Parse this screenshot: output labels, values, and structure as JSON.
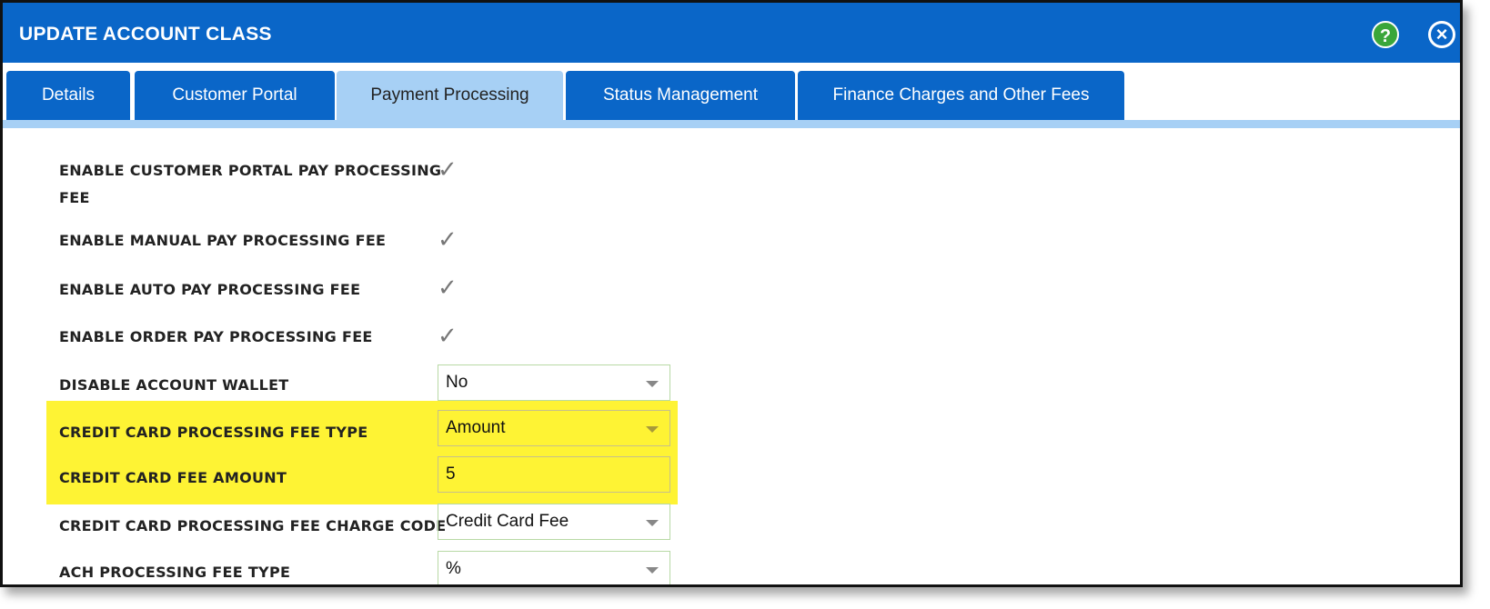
{
  "dialog": {
    "title": "UPDATE ACCOUNT CLASS"
  },
  "icons": {
    "help": "?",
    "close": "×"
  },
  "tabs": [
    {
      "label": "Details"
    },
    {
      "label": "Customer Portal"
    },
    {
      "label": "Payment Processing"
    },
    {
      "label": "Status Management"
    },
    {
      "label": "Finance Charges and Other Fees"
    }
  ],
  "form": {
    "enable_customer_portal_fee": {
      "label_line1": "ENABLE CUSTOMER PORTAL PAY PROCESSING",
      "label_line2": "FEE",
      "checked": true
    },
    "enable_manual_fee": {
      "label": "ENABLE MANUAL PAY PROCESSING FEE",
      "checked": true
    },
    "enable_auto_fee": {
      "label": "ENABLE AUTO PAY PROCESSING FEE",
      "checked": true
    },
    "enable_order_fee": {
      "label": "ENABLE ORDER PAY PROCESSING FEE",
      "checked": true
    },
    "disable_wallet": {
      "label": "DISABLE ACCOUNT WALLET",
      "value": "No"
    },
    "cc_fee_type": {
      "label": "CREDIT CARD PROCESSING FEE TYPE",
      "value": "Amount"
    },
    "cc_fee_amount": {
      "label": "CREDIT CARD FEE AMOUNT",
      "value": "5"
    },
    "cc_fee_charge_code": {
      "label": "CREDIT CARD PROCESSING FEE CHARGE CODE",
      "value": "Credit Card Fee"
    },
    "ach_fee_type": {
      "label": "ACH PROCESSING FEE TYPE",
      "value": "%"
    }
  },
  "colors": {
    "header": "#0a66c8",
    "active_tab": "#a7d0f5",
    "highlight": "#fef334",
    "help": "#3aa63a"
  }
}
